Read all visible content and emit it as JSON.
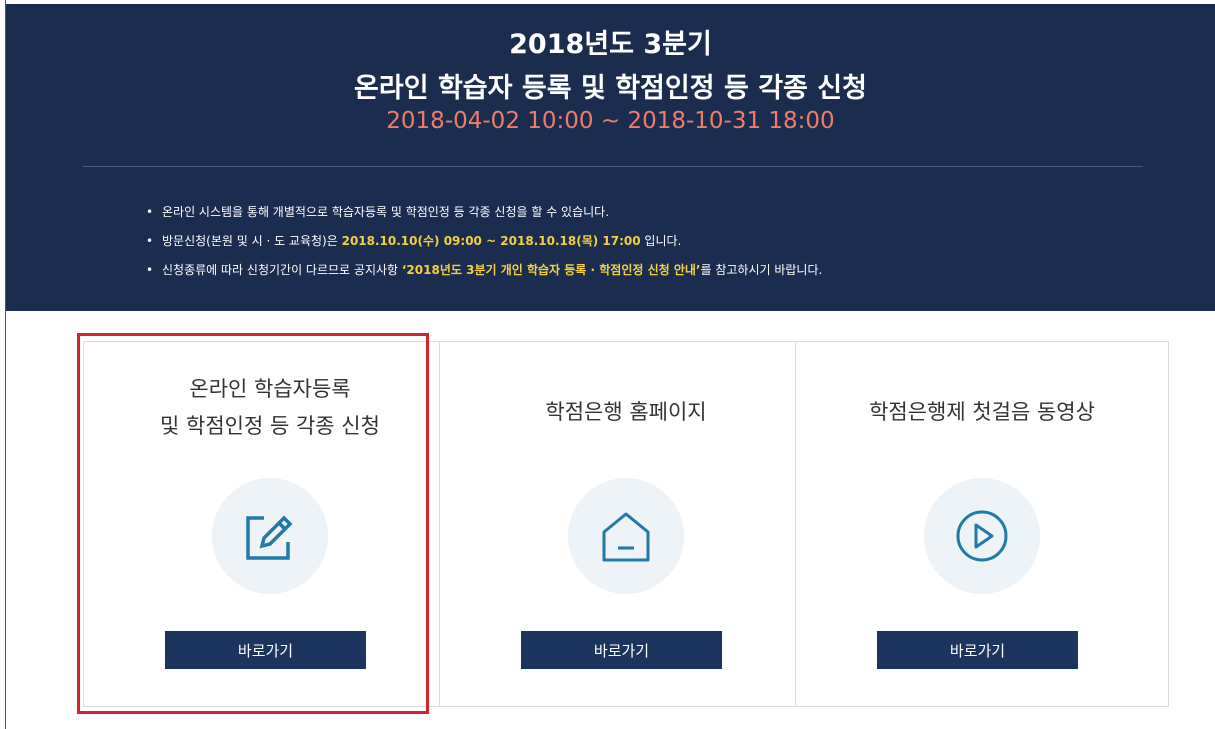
{
  "banner": {
    "title_line1": "2018년도 3분기",
    "title_line2": "온라인 학습자 등록 및 학점인정 등 각종 신청",
    "period": "2018-04-02 10:00 ~ 2018-10-31 18:00",
    "notes": [
      {
        "text": "온라인 시스템을 통해 개별적으로 학습자등록 및 학점인정 등 각종 신청을 할 수 있습니다."
      },
      {
        "before": "방문신청(본원 및 시 · 도 교육청)은 ",
        "highlight": "2018.10.10(수) 09:00 ~ 2018.10.18(목) 17:00",
        "after": " 입니다."
      },
      {
        "before": "신청종류에 따라 신청기간이 다르므로 공지사항 ",
        "highlight": "‘2018년도 3분기 개인 학습자 등록 · 학점인정 신청 안내’",
        "after": "를 참고하시기 바랍니다."
      }
    ]
  },
  "cards": [
    {
      "title_line1": "온라인 학습자등록",
      "title_line2": "및 학점인정 등 각종 신청",
      "icon": "edit-icon",
      "button_label": "바로가기"
    },
    {
      "title": "학점은행 홈페이지",
      "icon": "home-icon",
      "button_label": "바로가기"
    },
    {
      "title": "학점은행제 첫걸음 동영상",
      "icon": "play-icon",
      "button_label": "바로가기"
    }
  ],
  "colors": {
    "banner_bg": "#1b2d4f",
    "period_text": "#f07c67",
    "highlight_text": "#f4d03f",
    "button_bg": "#1b355e",
    "icon_stroke": "#1f7aa8",
    "selection_border": "#d6222a"
  }
}
